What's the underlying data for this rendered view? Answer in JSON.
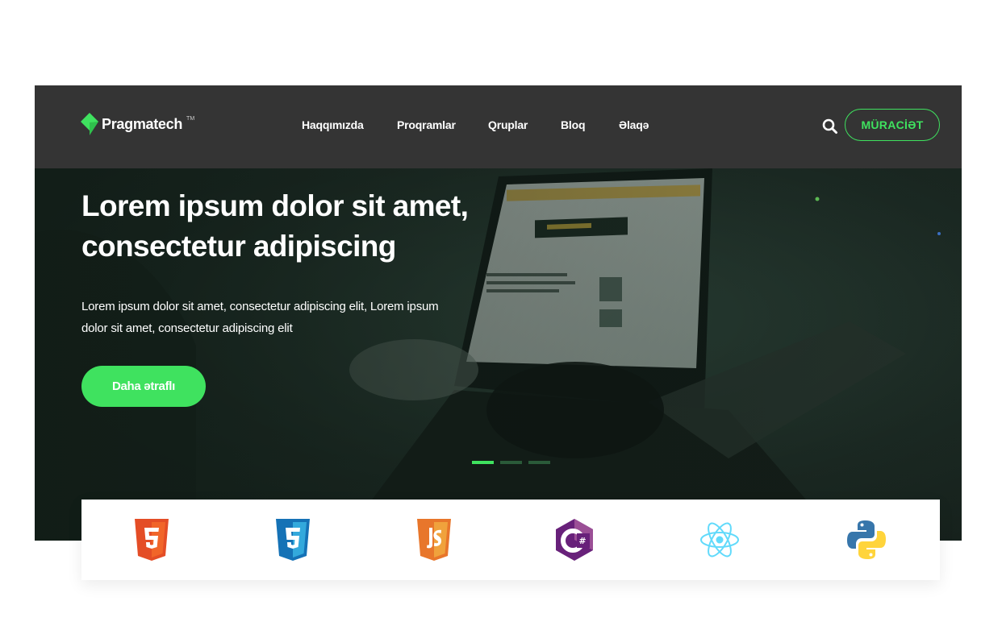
{
  "brand": {
    "name": "Pragmatech",
    "trademark": "TM",
    "accent_color": "#3fe25f",
    "header_color": "#343434"
  },
  "nav": {
    "items": [
      {
        "label": "Haqqımızda"
      },
      {
        "label": "Proqramlar"
      },
      {
        "label": "Qruplar"
      },
      {
        "label": "Bloq"
      },
      {
        "label": "Əlaqə"
      }
    ],
    "apply_label": "MÜRACİƏT",
    "search_icon": "search-icon"
  },
  "hero": {
    "title": "Lorem ipsum dolor sit amet, consectetur adipiscing",
    "text": "Lorem ipsum dolor sit amet, consectetur adipiscing elit, Lorem ipsum dolor sit amet, consectetur adipiscing elit",
    "button_label": "Daha ətraflı",
    "slides_total": 3,
    "active_slide": 1
  },
  "technologies": [
    {
      "icon": "html5-icon",
      "color": "#e44d26"
    },
    {
      "icon": "css3-icon",
      "color": "#1572b6"
    },
    {
      "icon": "javascript-icon",
      "color": "#f07f2a"
    },
    {
      "icon": "csharp-icon",
      "color": "#68217a"
    },
    {
      "icon": "react-icon",
      "color": "#61dafb"
    },
    {
      "icon": "python-icon",
      "color": "#3776ab"
    }
  ]
}
